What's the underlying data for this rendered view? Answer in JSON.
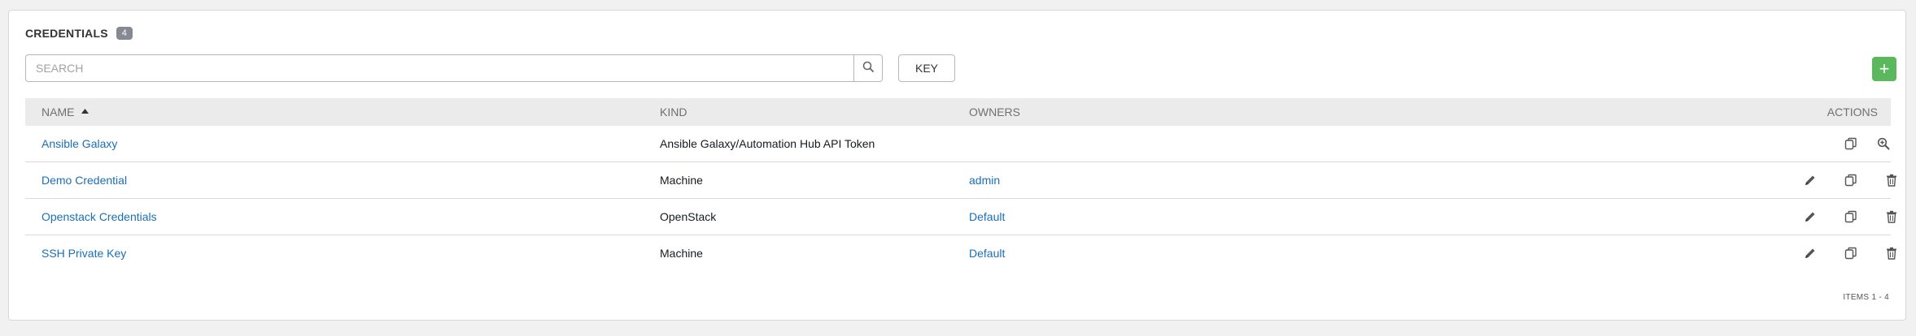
{
  "header": {
    "title": "CREDENTIALS",
    "count": "4"
  },
  "search": {
    "placeholder": "SEARCH"
  },
  "key_label": "KEY",
  "add_label": "+",
  "table": {
    "columns": {
      "name": "NAME",
      "kind": "KIND",
      "owners": "OWNERS",
      "actions": "ACTIONS"
    },
    "sort_icon": "sort-ascending-icon",
    "rows": [
      {
        "name": "Ansible Galaxy",
        "kind": "Ansible Galaxy/Automation Hub API Token",
        "owners": "",
        "actions": [
          "copy-icon",
          "view-icon"
        ]
      },
      {
        "name": "Demo Credential",
        "kind": "Machine",
        "owners": "admin",
        "actions": [
          "edit-icon",
          "copy-icon",
          "delete-icon"
        ]
      },
      {
        "name": "Openstack Credentials",
        "kind": "OpenStack",
        "owners": "Default",
        "actions": [
          "edit-icon",
          "copy-icon",
          "delete-icon"
        ]
      },
      {
        "name": "SSH Private Key",
        "kind": "Machine",
        "owners": "Default",
        "actions": [
          "edit-icon",
          "copy-icon",
          "delete-icon"
        ]
      }
    ]
  },
  "footer": {
    "items_text": "ITEMS  1 - 4"
  },
  "colors": {
    "link": "#1a6fb6",
    "add_button": "#5cb85c",
    "badge": "#848992",
    "header_bg": "#ebebeb"
  }
}
